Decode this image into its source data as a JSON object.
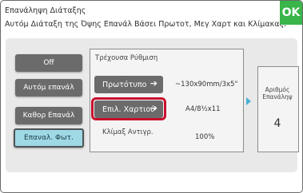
{
  "header": {
    "title": "Επανάληψη Διάταξης",
    "subtitle": "Αυτόμ Διάταξη της Όψης Επανάλ Βάσει Πρωτοτ, Μεγ Χαρτ και Κλίμακας.",
    "ok_label": "OK"
  },
  "modes": [
    {
      "label": "Off"
    },
    {
      "label": "Αυτόμ επανάλ"
    },
    {
      "label": "Καθορ Επανάλ"
    },
    {
      "label": "Επαναλ. Φωτ.",
      "active": true
    }
  ],
  "settings": {
    "title": "Τρέχουσα Ρύθμιση",
    "original_label": "Πρωτότυπο",
    "original_value": "~130x90mm/3x5\"",
    "paper_label": "Επιλ. Χαρτιού",
    "paper_value": "A4/8½x11",
    "ratio_label": "Κλίμαξ Αντιγρ.",
    "ratio_value": "100%"
  },
  "copies": {
    "label_line1": "Αριθμός",
    "label_line2": "Επανάληψ",
    "value": "4"
  },
  "colors": {
    "ok": "#39b54a",
    "active_mode": "#9fd9e6",
    "highlight": "#c8102e",
    "button": "#6b6b6b"
  },
  "icons": {
    "arrow": "right-arrow-icon",
    "triangle": "right-triangle-icon"
  }
}
